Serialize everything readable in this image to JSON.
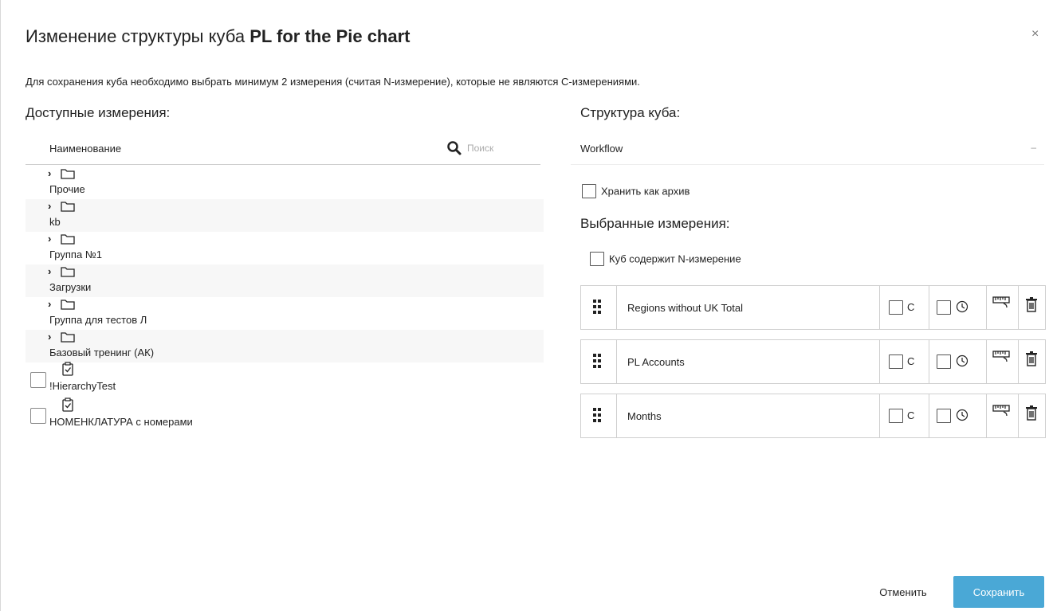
{
  "dialog": {
    "title_prefix": "Изменение структуры куба",
    "cube_name": "PL for the Pie chart",
    "close_label": "×",
    "info": "Для сохранения куба необходимо выбрать минимум 2 измерения (считая N-измерение), которые не являются C-измерениями."
  },
  "available": {
    "heading": "Доступные измерения:",
    "column_name": "Наименование",
    "search_placeholder": "Поиск",
    "folders": [
      {
        "label": "Прочие"
      },
      {
        "label": "kb"
      },
      {
        "label": "Группа №1"
      },
      {
        "label": "Загрузки"
      },
      {
        "label": "Группа для тестов Л"
      },
      {
        "label": "Базовый тренинг (АК)"
      }
    ],
    "dimensions": [
      {
        "label": "!HierarchyTest",
        "checked": false
      },
      {
        "label": "НОМЕНКЛАТУРА с номерами",
        "checked": false
      }
    ]
  },
  "structure": {
    "heading": "Структура куба:",
    "workflow_value": "Workflow",
    "workflow_arrow": "–",
    "archive_label": "Хранить как архив",
    "archive_checked": false,
    "selected_heading": "Выбранные измерения:",
    "n_dim_label": "Куб содержит N-измерение",
    "n_dim_checked": false,
    "c_label": "C",
    "selected_dims": [
      {
        "name": "Regions without UK Total",
        "c": false,
        "time": false
      },
      {
        "name": "PL Accounts",
        "c": false,
        "time": false
      },
      {
        "name": "Months",
        "c": false,
        "time": false
      }
    ]
  },
  "footer": {
    "cancel_label": "Отменить",
    "save_label": "Сохранить"
  },
  "colors": {
    "primary": "#4aa8d6",
    "border": "#cfcfcf",
    "stripe": "#f7f7f7"
  },
  "icons": [
    "close-icon",
    "search-icon",
    "chevron-right-icon",
    "folder-icon",
    "clipboard-check-icon",
    "drag-handle-icon",
    "clock-icon",
    "ruler-icon",
    "trash-icon"
  ]
}
